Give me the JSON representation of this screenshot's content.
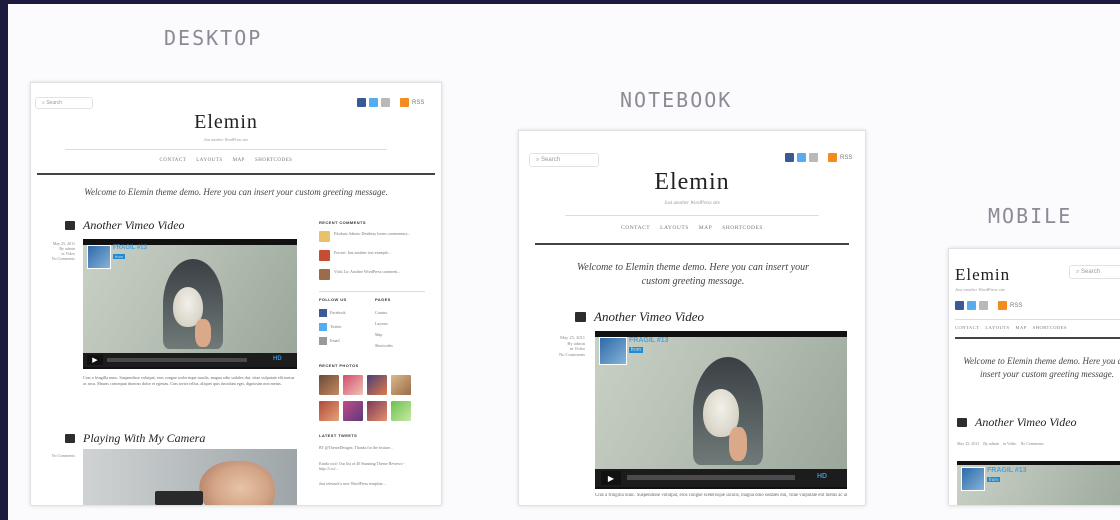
{
  "labels": {
    "desktop": "DESKTOP",
    "notebook": "NOTEBOOK",
    "mobile": "MOBILE"
  },
  "site": {
    "logo": "Elemin",
    "tagline": "Just another WordPress site",
    "search_placeholder": "Search",
    "rss_label": "RSS",
    "nav": [
      "CONTACT",
      "LAYOUTS",
      "MAP",
      "SHORTCODES"
    ],
    "welcome": "Welcome to Elemin theme demo. Here you can insert your custom greeting message.",
    "post1": {
      "title": "Another Vimeo Video",
      "date": "May 25, 2011",
      "author": "By admin",
      "category": "in Video",
      "comments": "No Comments",
      "video_title": "FRAGIL #13",
      "video_sub": "from ",
      "hd": "HD",
      "excerpt": "Cras a fringilla nunc. Suspendisse volutpat, eros congue scelerisque iaculis, magna odio sodales dui, vitae vulputate elit metus ac arcu. Mauris consequat rhoncus dolor et egestas. Cras tortor tellus, aliquet quis tincidunt eget, dignissim non metus."
    },
    "post2": {
      "title": "Playing With My Camera",
      "comments": "No Comments"
    },
    "sidebar": {
      "recent_comments_h": "RECENT COMMENTS",
      "comments": [
        "Elrobust Admin: Deathray lorem commentary...",
        "Forrest: Just another text example...",
        "Vicki Lu: Another WordPress comment..."
      ],
      "follow_h": "FOLLOW US",
      "follow": [
        "Facebook",
        "Twitter",
        "Email"
      ],
      "pages_h": "PAGES",
      "pages": [
        "Contact",
        "Layouts",
        "Map",
        "Shortcodes"
      ],
      "photos_h": "RECENT PHOTOS",
      "tweets_h": "LATEST TWEETS",
      "tweets": [
        "RT @ThemeDesigns: Thanks for the feature...",
        "Kinda cool: Our list of 40 Stunning Theme Reviews - http://t.co/...",
        "Just released a new WordPress template..."
      ]
    }
  },
  "colors": {
    "accent": "#3b5998",
    "twitter": "#55acee",
    "rss": "#f48b1d",
    "vimeo": "#1f8bd2",
    "page_bg": "#1d1a3f"
  }
}
